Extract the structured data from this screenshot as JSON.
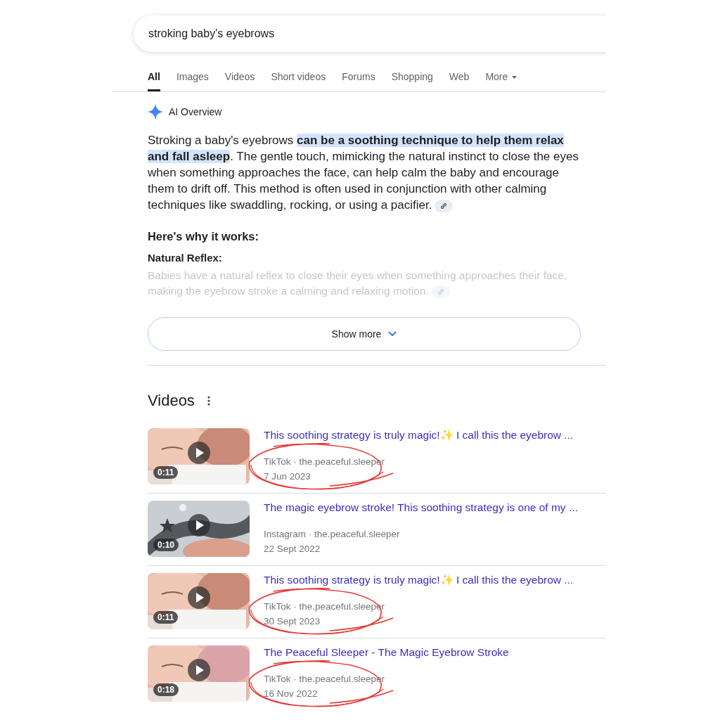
{
  "search": {
    "value": "stroking baby's eyebrows"
  },
  "tabs": [
    {
      "label": "All",
      "selected": true
    },
    {
      "label": "Images",
      "selected": false
    },
    {
      "label": "Videos",
      "selected": false
    },
    {
      "label": "Short videos",
      "selected": false
    },
    {
      "label": "Forums",
      "selected": false
    },
    {
      "label": "Shopping",
      "selected": false
    },
    {
      "label": "Web",
      "selected": false
    },
    {
      "label": "More",
      "selected": false,
      "kind": "menu"
    }
  ],
  "ai_overview": {
    "label": "AI Overview",
    "summary": [
      {
        "text": "Stroking a baby's eyebrows ",
        "highlighted": false
      },
      {
        "text": "can be a soothing technique to help them relax and fall asleep",
        "highlighted": true
      },
      {
        "text": ". The gentle touch, mimicking the natural instinct to close the eyes when something approaches the face, can help calm the baby and encourage them to drift off. This method is often used in conjunction with other calming techniques like swaddling, rocking, or using a pacifier.",
        "highlighted": false
      }
    ],
    "heading": "Here's why it works:",
    "points": [
      {
        "title": "Natural Reflex:",
        "text": "Babies have a natural reflex to close their eyes when something approaches their face, making the eyebrow stroke a calming and relaxing motion."
      }
    ],
    "show_more": "Show more"
  },
  "videos": {
    "heading": "Videos",
    "results": [
      {
        "title": "This soothing strategy is truly magic!✨ I call this the eyebrow ...",
        "source": "TikTok · the.peaceful.sleeper",
        "date": "7 Jun 2023",
        "duration": "0:11",
        "annotated": true
      },
      {
        "title": "The magic eyebrow stroke! This soothing strategy is one of my ...",
        "source": "Instagram · the.peaceful.sleeper",
        "date": "22 Sept 2022",
        "duration": "0:10",
        "annotated": false
      },
      {
        "title": "This soothing strategy is truly magic!✨ I call this the eyebrow ...",
        "source": "TikTok · the.peaceful.sleeper",
        "date": "30 Sept 2023",
        "duration": "0:11",
        "annotated": true
      },
      {
        "title": "The Peaceful Sleeper - The Magic Eyebrow Stroke",
        "source": "TikTok · the.peaceful.sleeper",
        "date": "16 Nov 2022",
        "duration": "0:18",
        "annotated": true
      }
    ]
  }
}
